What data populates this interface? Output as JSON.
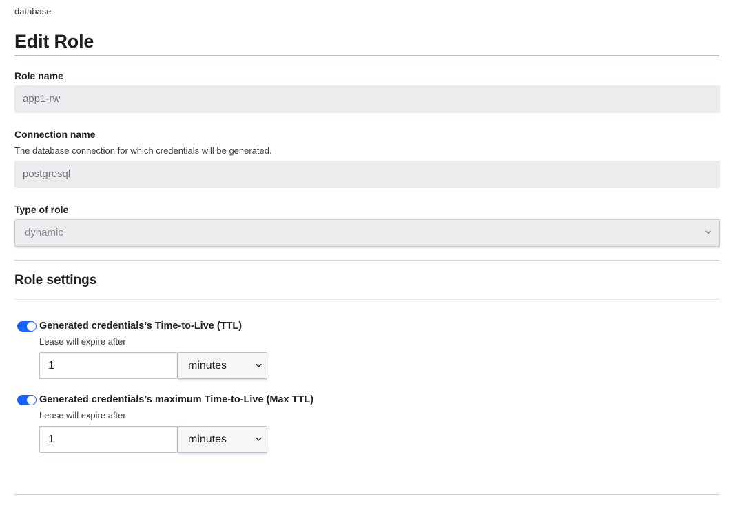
{
  "breadcrumb": "database",
  "page_title": "Edit Role",
  "role_name": {
    "label": "Role name",
    "value": "app1-rw"
  },
  "connection_name": {
    "label": "Connection name",
    "help": "The database connection for which credentials will be generated.",
    "value": "postgresql"
  },
  "role_type": {
    "label": "Type of role",
    "selected": "dynamic"
  },
  "role_settings": {
    "title": "Role settings",
    "ttl": {
      "enabled": true,
      "label": "Generated credentials’s Time-to-Live (TTL)",
      "help": "Lease will expire after",
      "value": "1",
      "unit": "minutes"
    },
    "max_ttl": {
      "enabled": true,
      "label": "Generated credentials’s maximum Time-to-Live (Max TTL)",
      "help": "Lease will expire after",
      "value": "1",
      "unit": "minutes"
    }
  },
  "colors": {
    "toggle_on": "#1563ff",
    "readonly_bg": "#ebeced"
  }
}
